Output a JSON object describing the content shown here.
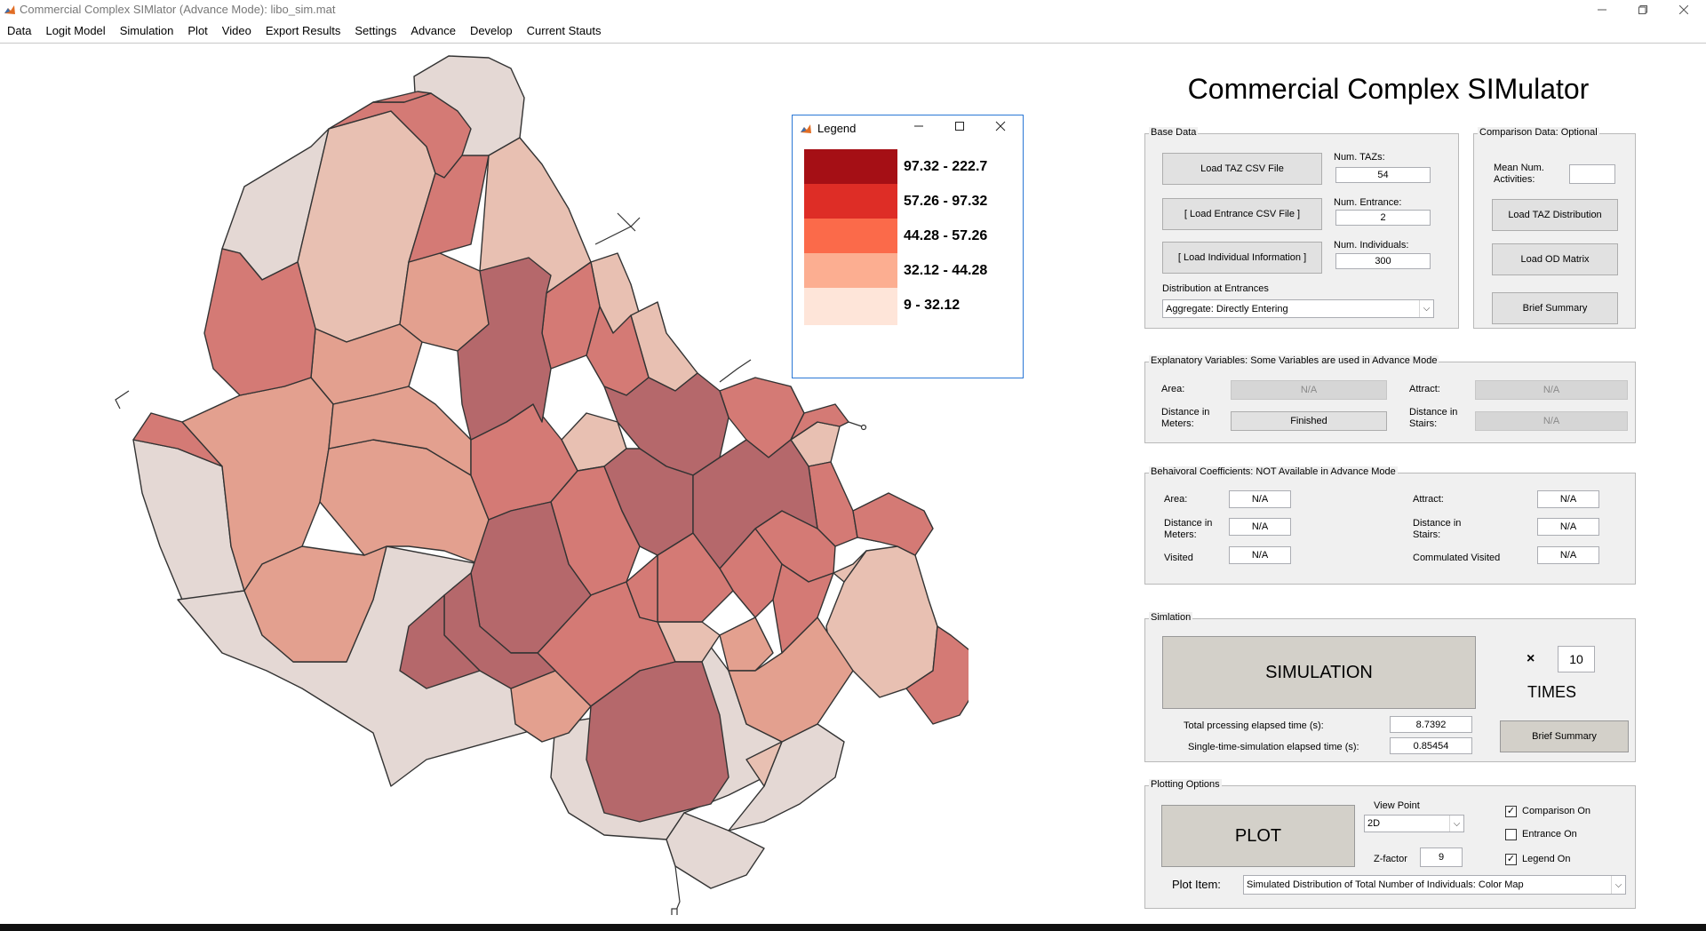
{
  "window": {
    "title": "Commercial Complex SIMlator (Advance Mode): libo_sim.mat"
  },
  "menu": [
    "Data",
    "Logit Model",
    "Simulation",
    "Plot",
    "Video",
    "Export Results",
    "Settings",
    "Advance",
    "Develop",
    "Current Stauts"
  ],
  "app_title": "Commercial Complex SIMulator",
  "base_data": {
    "title": "Base Data",
    "load_taz": "Load TAZ CSV File",
    "load_entrance": "[ Load Entrance CSV File ]",
    "load_individual": "[ Load Individual Information ]",
    "num_taz_label": "Num. TAZs:",
    "num_taz_value": "54",
    "num_entrance_label": "Num. Entrance:",
    "num_entrance_value": "2",
    "num_individuals_label": "Num. Individuals:",
    "num_individuals_value": "300",
    "dist_label": "Distribution at Entrances",
    "dist_value": "Aggregate: Directly Entering"
  },
  "comparison": {
    "title": "Comparison Data: Optional",
    "mean_label_1": "Mean Num.",
    "mean_label_2": "Activities:",
    "mean_value": "",
    "load_taz_dist": "Load TAZ Distribution",
    "load_od": "Load OD Matrix",
    "brief_summary": "Brief Summary"
  },
  "explanatory": {
    "title": "Explanatory Variables: Some Variables are used in Advance Mode",
    "area_label": "Area:",
    "area_value": "N/A",
    "attract_label": "Attract:",
    "attract_value": "N/A",
    "dist_m_label_1": "Distance in",
    "dist_m_label_2": "Meters:",
    "dist_m_value": "Finished",
    "dist_s_label_1": "Distance in",
    "dist_s_label_2": "Stairs:",
    "dist_s_value": "N/A"
  },
  "behavioral": {
    "title": "Behaivoral Coefficients: NOT Available in Advance Mode",
    "area_label": "Area:",
    "area_value": "N/A",
    "attract_label": "Attract:",
    "attract_value": "N/A",
    "dist_m_label_1": "Distance in",
    "dist_m_label_2": "Meters:",
    "dist_m_value": "N/A",
    "dist_s_label_1": "Distance in",
    "dist_s_label_2": "Stairs:",
    "dist_s_value": "N/A",
    "visited_label": "Visited",
    "visited_value": "N/A",
    "cumulated_label": "Commulated Visited",
    "cumulated_value": "N/A"
  },
  "simulation": {
    "title": "Simlation",
    "run_label": "SIMULATION",
    "times_symbol": "×",
    "times_value": "10",
    "times_label": "TIMES",
    "total_label": "Total prcessing elapsed time (s):",
    "total_value": "8.7392",
    "single_label": "Single-time-simulation elapsed time (s):",
    "single_value": "0.85454",
    "brief_summary": "Brief Summary"
  },
  "plotting": {
    "title": "Plotting Options",
    "plot_label": "PLOT",
    "viewpoint_label": "View Point",
    "viewpoint_value": "2D",
    "zfactor_label": "Z-factor",
    "zfactor_value": "9",
    "comparison_on": "Comparison On",
    "entrance_on": "Entrance On",
    "legend_on": "Legend On",
    "comparison_checked": true,
    "entrance_checked": false,
    "legend_checked": true,
    "plot_item_label": "Plot Item:",
    "plot_item_value": "Simulated Distribution of Total Number of Individuals: Color Map"
  },
  "legend": {
    "title": "Legend",
    "items": [
      {
        "range": "97.32 - 222.7",
        "color": "#a50f15"
      },
      {
        "range": "57.26 - 97.32",
        "color": "#de2d26"
      },
      {
        "range": "44.28 - 57.26",
        "color": "#fb6a4a"
      },
      {
        "range": "32.12 - 44.28",
        "color": "#fcae91"
      },
      {
        "range": "9 - 32.12",
        "color": "#fee5d9"
      }
    ]
  },
  "map_colors": {
    "c1": "#b5686b",
    "c2": "#d47a75",
    "c3": "#e3a08f",
    "c4": "#e8c0b2",
    "c5": "#e4d8d4"
  },
  "icons": [
    "matlab-icon",
    "minimize-icon",
    "maximize-icon",
    "close-icon",
    "chevron-down-icon",
    "checkmark-icon"
  ]
}
